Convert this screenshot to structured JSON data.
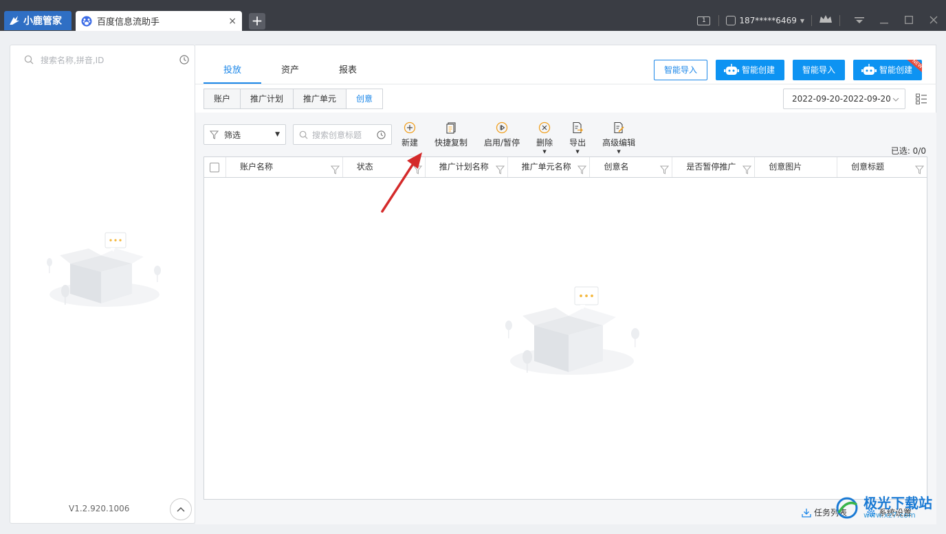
{
  "titlebar": {
    "app_name": "小鹿管家",
    "tab_title": "百度信息流助手",
    "tab_close": "×",
    "new_tab": "+",
    "window_count": "1",
    "user": "187*****6469"
  },
  "left_panel": {
    "search_placeholder": "搜索名称,拼音,ID",
    "version": "V1.2.920.1006"
  },
  "main_tabs": [
    "投放",
    "资产",
    "报表"
  ],
  "top_buttons": {
    "import1": "智能导入",
    "create1": "智能创建",
    "import2": "智能导入",
    "create2": "智能创建",
    "new_tag": "NEW"
  },
  "sub_tabs": [
    "账户",
    "推广计划",
    "推广单元",
    "创意"
  ],
  "date_range": "2022-09-20-2022-09-20",
  "filter_label": "筛选",
  "search_placeholder": "搜索创意标题",
  "tools": {
    "new": "新建",
    "copy": "快捷复制",
    "toggle": "启用/暂停",
    "delete": "删除",
    "export": "导出",
    "advanced": "高级编辑"
  },
  "selected_count": "已选: 0/0",
  "columns": [
    "账户名称",
    "状态",
    "推广计划名称",
    "推广单元名称",
    "创意名",
    "是否暂停推广",
    "创意图片",
    "创意标题"
  ],
  "footer": {
    "tasks": "任务列表",
    "settings": "系统设置"
  },
  "watermark": {
    "title": "极光下载站",
    "url": "www.xz7.com"
  },
  "colors": {
    "accent": "#1a86e8",
    "button_blue": "#0d93f2",
    "titlebar": "#3a3d44",
    "icon_orange": "#f0a020"
  }
}
